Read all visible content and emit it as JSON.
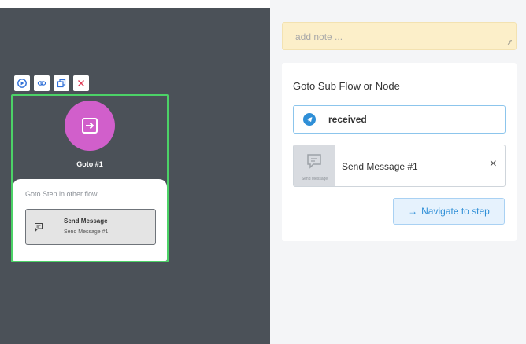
{
  "canvas": {
    "toolbar": [
      {
        "icon": "play-circle-icon"
      },
      {
        "icon": "link-icon"
      },
      {
        "icon": "duplicate-icon"
      },
      {
        "icon": "close-icon"
      }
    ],
    "node": {
      "icon": "goto-arrow-icon",
      "title": "Goto #1",
      "step_label": "Goto Step in other flow",
      "target": {
        "title": "Send Message",
        "subtitle": "Send Message #1",
        "icon": "message-icon"
      }
    }
  },
  "panel": {
    "note_placeholder": "add note ...",
    "goto_label": "Goto Sub Flow or Node",
    "flow_select": {
      "value": "received",
      "icon": "telegram-icon"
    },
    "step": {
      "thumb_label": "Send Message",
      "name": "Send Message #1",
      "remove_glyph": "×"
    },
    "navigate_button": {
      "arrow": "→",
      "label": "Navigate to step"
    }
  },
  "colors": {
    "canvas_bg": "#4b5158",
    "node_border": "#4cd267",
    "node_icon_bg": "#d15fcb",
    "note_bg": "#fcefc9",
    "accent": "#2f8fd7"
  }
}
